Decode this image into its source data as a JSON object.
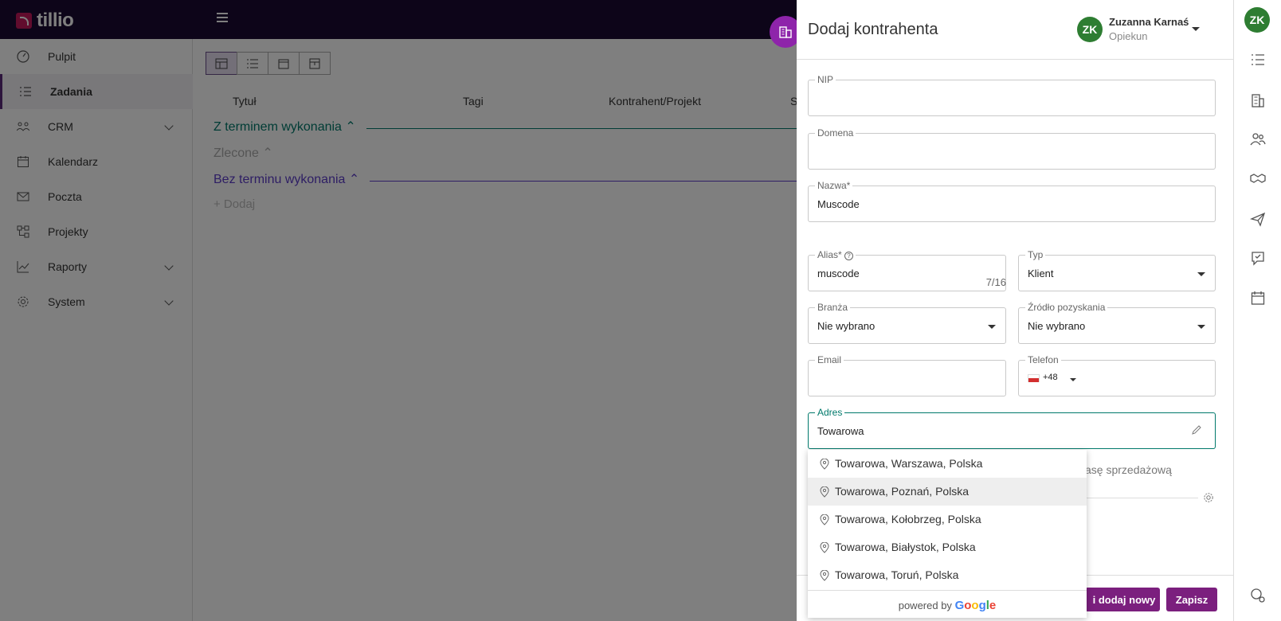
{
  "app": {
    "logo_text": "tillio"
  },
  "nav": {
    "items": [
      {
        "label": "Pulpit",
        "icon": "dashboard-gauge-icon"
      },
      {
        "label": "Zadania",
        "icon": "tasks-list-icon",
        "active": true
      },
      {
        "label": "CRM",
        "icon": "crm-people-icon",
        "expandable": true
      },
      {
        "label": "Kalendarz",
        "icon": "calendar-icon"
      },
      {
        "label": "Poczta",
        "icon": "mail-icon"
      },
      {
        "label": "Projekty",
        "icon": "projects-icon"
      },
      {
        "label": "Raporty",
        "icon": "reports-chart-icon",
        "expandable": true
      },
      {
        "label": "System",
        "icon": "settings-gear-icon",
        "expandable": true
      }
    ]
  },
  "tasks": {
    "columns": [
      "Tytuł",
      "Tagi",
      "Kontrahent/Projekt",
      "S"
    ],
    "group_with_deadline": "Z terminem wykonania",
    "group_delegated": "Zlecone",
    "group_without_deadline": "Bez terminu wykonania",
    "add_label": "+ Dodaj"
  },
  "panel": {
    "title": "Dodaj kontrahenta",
    "user": {
      "initials": "ZK",
      "name": "Zuzanna Karnaś",
      "role": "Opiekun"
    },
    "fields": {
      "nip": {
        "label": "NIP",
        "value": ""
      },
      "domain": {
        "label": "Domena",
        "value": ""
      },
      "name": {
        "label": "Nazwa*",
        "value": "Muscode"
      },
      "alias": {
        "label": "Alias*",
        "value": "muscode",
        "counter": "7/16"
      },
      "type": {
        "label": "Typ",
        "value": "Klient"
      },
      "industry": {
        "label": "Branża",
        "value": "Nie wybrano"
      },
      "source": {
        "label": "Źródło pozyskania",
        "value": "Nie wybrano"
      },
      "email": {
        "label": "Email",
        "value": ""
      },
      "phone": {
        "label": "Telefon",
        "prefix": "+48",
        "value": ""
      },
      "address": {
        "label": "Adres",
        "value": "Towarowa"
      }
    },
    "hidden_text_partial": "asę sprzedażową",
    "suggestions": [
      "Towarowa, Warszawa, Polska",
      "Towarowa, Poznań, Polska",
      "Towarowa, Kołobrzeg, Polska",
      "Towarowa, Białystok, Polska",
      "Towarowa, Toruń, Polska"
    ],
    "powered_by": "powered by",
    "google": [
      "G",
      "o",
      "o",
      "g",
      "l",
      "e"
    ],
    "buttons": {
      "save_and_new": "i dodaj nowy",
      "save": "Zapisz"
    }
  },
  "rightbar": {
    "initials": "ZK"
  },
  "colors": {
    "topbar": "#1b0a33",
    "accent": "#7b1f7e",
    "avatar": "#2e7d32",
    "focus": "#00796b"
  }
}
